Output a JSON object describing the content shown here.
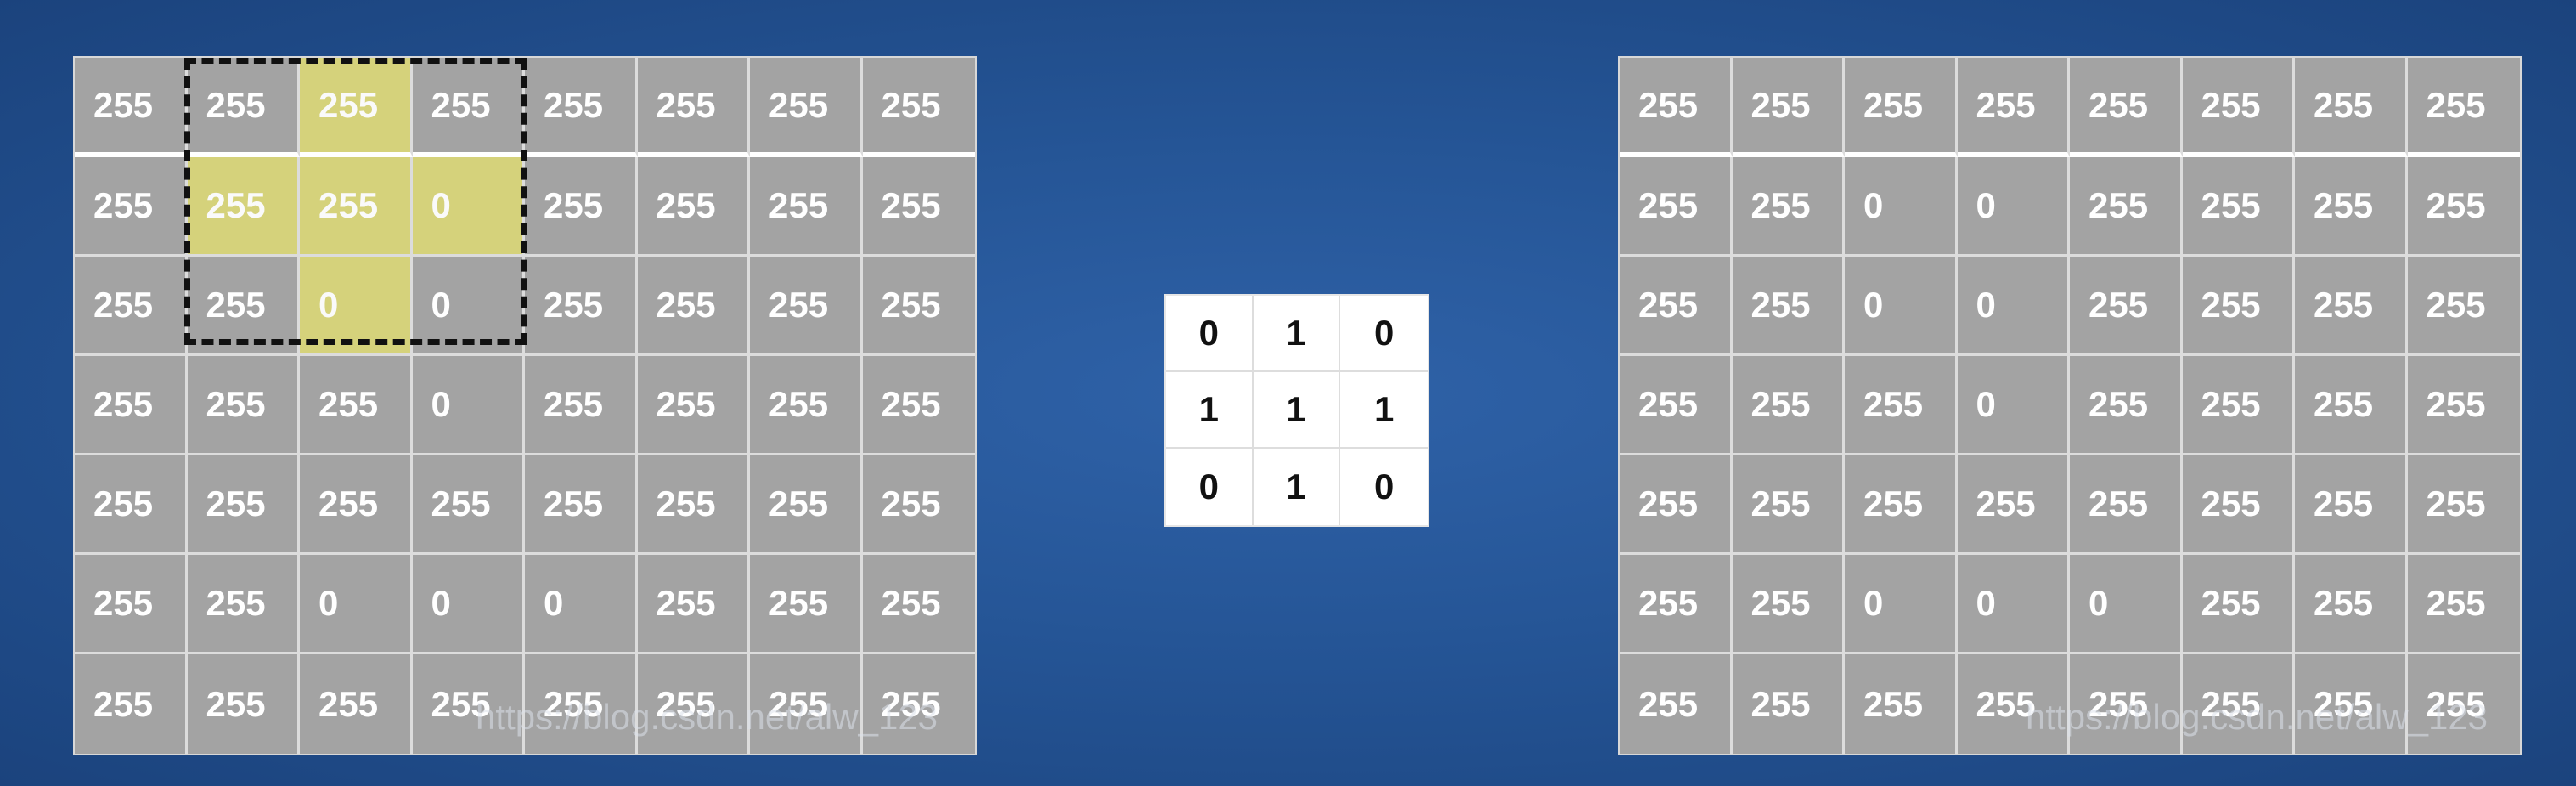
{
  "input_matrix": [
    [
      "255",
      "255",
      "255",
      "255",
      "255",
      "255",
      "255",
      "255"
    ],
    [
      "255",
      "255",
      "255",
      "0",
      "255",
      "255",
      "255",
      "255"
    ],
    [
      "255",
      "255",
      "0",
      "0",
      "255",
      "255",
      "255",
      "255"
    ],
    [
      "255",
      "255",
      "255",
      "0",
      "255",
      "255",
      "255",
      "255"
    ],
    [
      "255",
      "255",
      "255",
      "255",
      "255",
      "255",
      "255",
      "255"
    ],
    [
      "255",
      "255",
      "0",
      "0",
      "0",
      "255",
      "255",
      "255"
    ],
    [
      "255",
      "255",
      "255",
      "255",
      "255",
      "255",
      "255",
      "255"
    ]
  ],
  "highlighted_cells": [
    [
      0,
      2
    ],
    [
      1,
      1
    ],
    [
      1,
      2
    ],
    [
      1,
      3
    ],
    [
      2,
      2
    ]
  ],
  "kernel": [
    [
      "0",
      "1",
      "0"
    ],
    [
      "1",
      "1",
      "1"
    ],
    [
      "0",
      "1",
      "0"
    ]
  ],
  "output_matrix": [
    [
      "255",
      "255",
      "255",
      "255",
      "255",
      "255",
      "255",
      "255"
    ],
    [
      "255",
      "255",
      "0",
      "0",
      "255",
      "255",
      "255",
      "255"
    ],
    [
      "255",
      "255",
      "0",
      "0",
      "255",
      "255",
      "255",
      "255"
    ],
    [
      "255",
      "255",
      "255",
      "0",
      "255",
      "255",
      "255",
      "255"
    ],
    [
      "255",
      "255",
      "255",
      "255",
      "255",
      "255",
      "255",
      "255"
    ],
    [
      "255",
      "255",
      "0",
      "0",
      "0",
      "255",
      "255",
      "255"
    ],
    [
      "255",
      "255",
      "255",
      "255",
      "255",
      "255",
      "255",
      "255"
    ]
  ],
  "watermark": "https://blog.csdn.net/alw_123",
  "colors": {
    "background": "#255596",
    "cell_bg": "#a3a3a3",
    "highlight": "#e6e16e",
    "kernel_bg": "#ffffff"
  }
}
